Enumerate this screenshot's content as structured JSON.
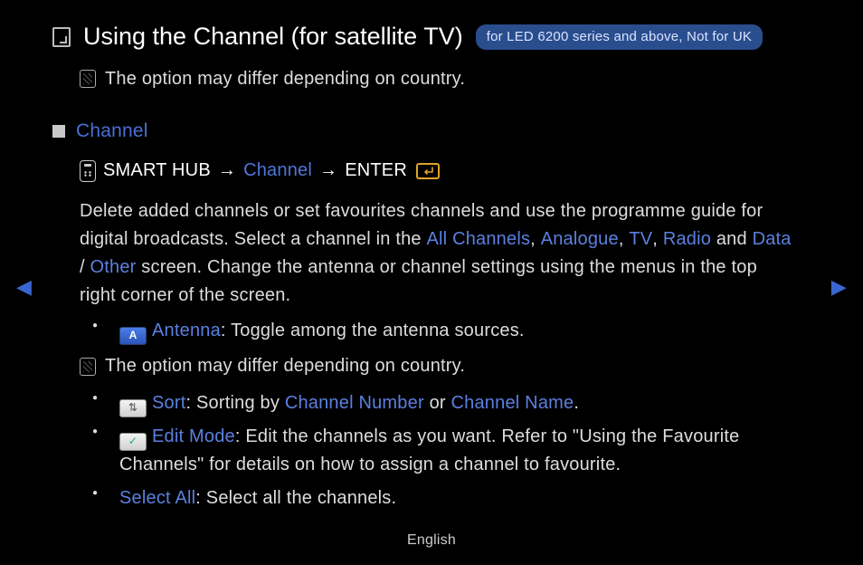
{
  "title": "Using the Channel (for satellite TV)",
  "badge": "for LED 6200 series and above, Not for UK",
  "top_note": "The option may differ depending on country.",
  "section": "Channel",
  "path": {
    "p1": "SMART HUB",
    "arrow": "→",
    "p2": "Channel",
    "p3": "ENTER"
  },
  "body": {
    "t1": "Delete added channels or set favourites channels and use the programme guide for digital broadcasts. Select a channel in the ",
    "all": "All Channels",
    "c1": ", ",
    "analogue": "Analogue",
    "c2": ", ",
    "tv": "TV",
    "c3": ", ",
    "radio": "Radio",
    "t2": " and ",
    "data": "Data",
    "slash": " / ",
    "other": "Other",
    "t3": " screen. Change the antenna or channel settings using the menus in the top right corner of the screen."
  },
  "items": {
    "antenna_label": "Antenna",
    "antenna_text": ": Toggle among the antenna sources.",
    "note2": "The option may differ depending on country.",
    "sort_label": "Sort",
    "sort_t1": ": Sorting by ",
    "sort_hl1": "Channel Number",
    "sort_or": " or ",
    "sort_hl2": "Channel Name",
    "sort_end": ".",
    "edit_label": "Edit Mode",
    "edit_text": ": Edit the channels as you want. Refer to \"Using the Favourite Channels\" for details on how to assign a channel to favourite.",
    "select_label": "Select All",
    "select_text": ": Select all the channels."
  },
  "icons": {
    "a_letter": "A",
    "sort_glyph": "⇅",
    "edit_glyph": "✓"
  },
  "footer": "English"
}
